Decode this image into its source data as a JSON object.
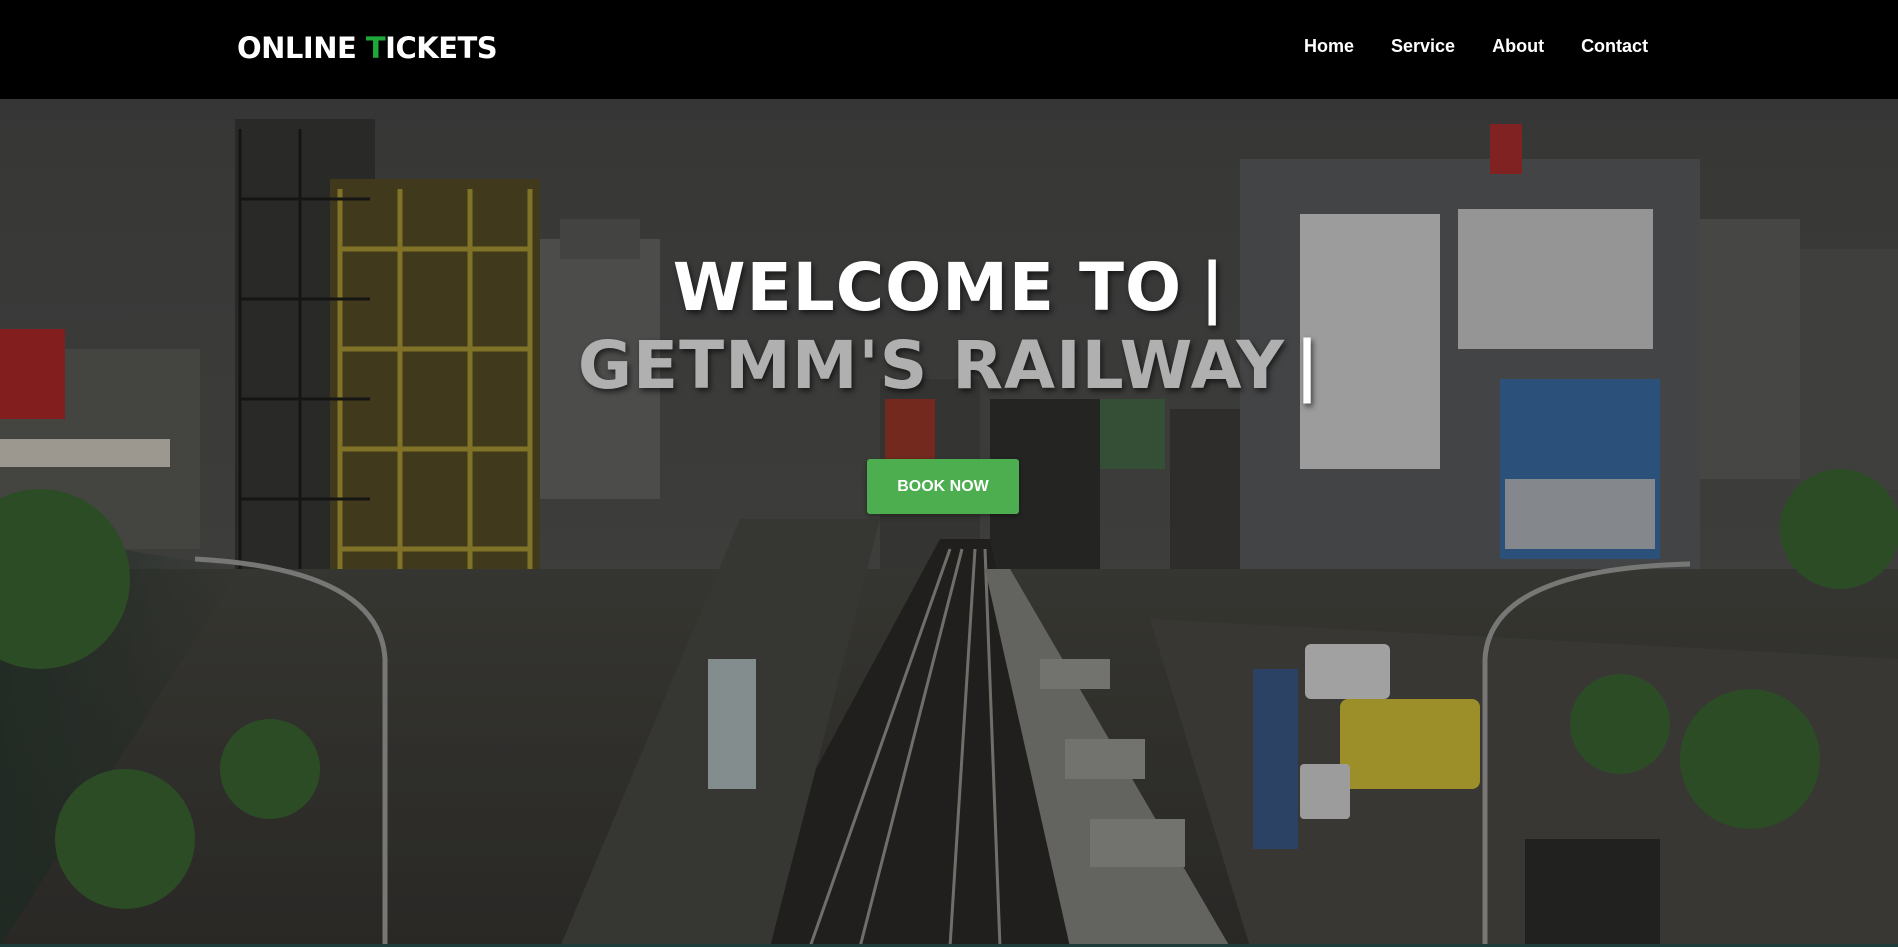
{
  "header": {
    "logo_part1": "ONLINE ",
    "logo_accent": "T",
    "logo_part2": "ICKETS",
    "nav": [
      {
        "label": "Home"
      },
      {
        "label": "Service"
      },
      {
        "label": "About"
      },
      {
        "label": "Contact"
      }
    ]
  },
  "hero": {
    "line1": "WELCOME TO",
    "line2": "GETMM'S RAILWAY",
    "cursor": "|",
    "book_button": "BOOK NOW"
  },
  "colors": {
    "accent": "#1fa83a",
    "button": "#4cae4f",
    "navbar": "#000000"
  },
  "icons": {
    "background": "city-railway-photo"
  }
}
